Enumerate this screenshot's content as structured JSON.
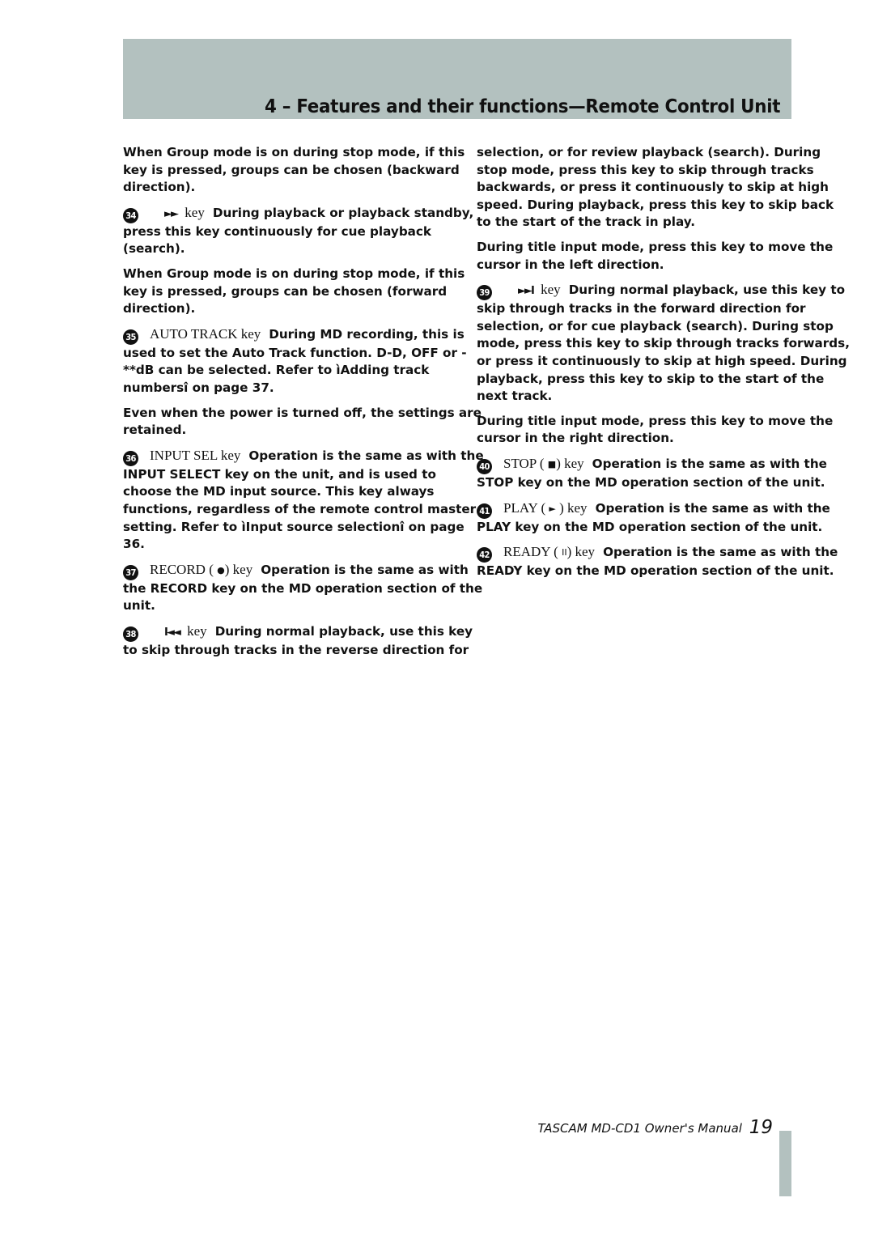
{
  "header": {
    "title": "4 – Features and their functions—Remote Control Unit",
    "band_color": "#b3c1bf"
  },
  "left_column": {
    "p1": "When Group mode is on during stop mode, if this key is pressed, groups can be chosen (backward direction).",
    "item34": {
      "number": "34",
      "symbol": "►►",
      "symbol_name": "fast-forward-icon",
      "key": "key",
      "text": "During playback or playback standby, press this key continuously for cue playback (search)."
    },
    "p2": "When Group mode is on during stop mode, if this key is pressed, groups can be chosen (forward direction).",
    "item35": {
      "number": "35",
      "key": "AUTO TRACK key",
      "text": "During MD recording, this is used to set the Auto Track function. D-D, OFF or -**dB can be selected. Refer to ìAdding track numbersî on page 37."
    },
    "p3": "Even when the power is turned off, the settings are retained.",
    "item36": {
      "number": "36",
      "key": "INPUT SEL key",
      "text": "Operation is the same as with the INPUT SELECT key on the unit, and is used to choose the MD input source. This key always functions, regardless of the remote control master setting. Refer to ìInput source selectionî on page 36."
    },
    "item37": {
      "number": "37",
      "key_prefix": "RECORD (",
      "key_symbol": "●",
      "key_suffix": ") key",
      "text": "Operation is the same as with the RECORD key on the MD operation section of the unit."
    },
    "item38": {
      "number": "38",
      "symbol": "I◄◄",
      "symbol_name": "skip-back-icon",
      "key": "key",
      "text": "During normal playback, use this key to skip through tracks in the reverse direction for"
    }
  },
  "right_column": {
    "p1": "selection, or for review playback (search). During stop mode, press this key to skip through tracks backwards, or press it continuously to skip at high speed. During playback, press this key to skip back to the start of the track in play.",
    "p2": "During title input mode, press this key to move the cursor in the left direction.",
    "item39": {
      "number": "39",
      "symbol": "►►I",
      "symbol_name": "skip-forward-icon",
      "key": "key",
      "text": "During normal playback, use this key to skip through tracks in the forward direction for selection, or for cue playback (search). During stop mode, press this key to skip through tracks forwards, or press it continuously to skip at high speed. During playback, press this key to skip to the start of the next track."
    },
    "p3": "During title input mode, press this key to move the cursor in the right direction.",
    "item40": {
      "number": "40",
      "key_prefix": "STOP (",
      "key_symbol": "■",
      "key_suffix": ") key",
      "text": "Operation is the same as with the STOP key on the MD operation section of the unit."
    },
    "item41": {
      "number": "41",
      "key_prefix": "PLAY (",
      "key_symbol": "►",
      "key_suffix": ") key",
      "text": "Operation is the same as with the PLAY key on the MD operation section of the unit."
    },
    "item42": {
      "number": "42",
      "key_prefix": "READY (",
      "key_symbol": "II",
      "key_suffix": ") key",
      "text": "Operation is the same as with the READY key on the MD operation section of the unit."
    }
  },
  "footer": {
    "brand": "TASCAM",
    "model": "MD-CD1",
    "manual": "Owner's Manual",
    "page_number": "19"
  }
}
